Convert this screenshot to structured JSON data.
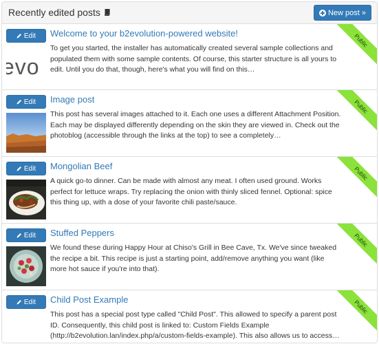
{
  "header": {
    "title": "Recently edited posts",
    "new_post_label": "New post »"
  },
  "colors": {
    "primary": "#337ab7",
    "ribbon": "#8be23a",
    "border": "#dddddd"
  },
  "edit_label": "Edit",
  "posts": [
    {
      "title": "Welcome to your b2evolution-powered website!",
      "excerpt": "To get you started, the installer has automatically created several sample collections and populated them with some sample contents. Of course, this starter structure is all yours to edit. Until you do that, though, here's what you will find on this…",
      "status": "Public",
      "thumb_text": "evo"
    },
    {
      "title": "Image post",
      "excerpt": "This post has several images attached to it. Each one uses a different Attachment Position. Each may be displayed differently depending on the skin they are viewed in. Check out the photoblog (accessible through the links at the top) to see a completely…",
      "status": "Public"
    },
    {
      "title": "Mongolian Beef",
      "excerpt": "A quick go-to dinner. Can be made with almost any meat. I often used ground. Works perfect for lettuce wraps. Try replacing the onion with thinly sliced fennel. Optional: spice this thing up, with a dose of your favorite chili paste/sauce.",
      "status": "Public"
    },
    {
      "title": "Stuffed Peppers",
      "excerpt": "We found these during Happy Hour at Chiso's Grill in Bee Cave, Tx. We've since tweaked the recipe a bit. This recipe is just a starting point, add/remove anything you want (like more hot sauce if you're into that).",
      "status": "Public"
    },
    {
      "title": "Child Post Example",
      "excerpt": "This post has a special post type called \"Child Post\". This allowed to specify a parent post ID. Consequently, this child post is linked to: Custom Fields Example (http://b2evolution.lan/index.php/a/custom-fields-example). This also allows us to access…",
      "status": "Public"
    }
  ]
}
